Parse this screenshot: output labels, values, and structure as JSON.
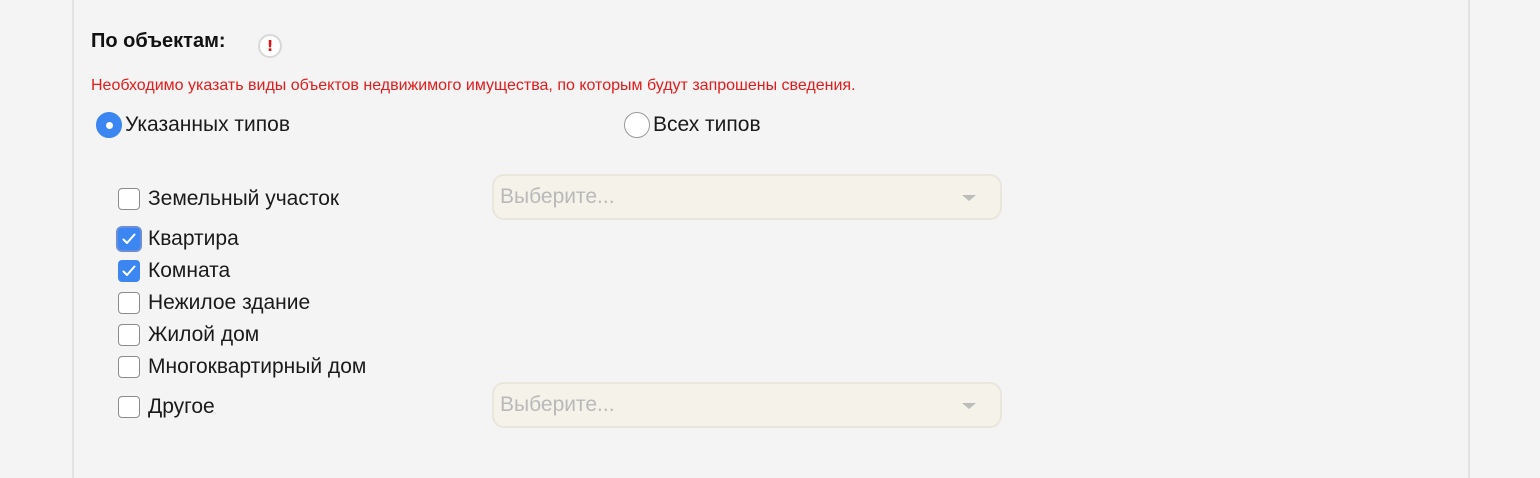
{
  "section": {
    "title": "По объектам:",
    "help_icon": "exclamation-icon",
    "error_message": "Необходимо указать виды объектов недвижимого имущества, по которым будут запрошены сведения."
  },
  "scope": {
    "options": [
      {
        "label": "Указанных типов",
        "checked": true
      },
      {
        "label": "Всех типов",
        "checked": false
      }
    ]
  },
  "object_types": [
    {
      "label": "Земельный участок",
      "checked": false
    },
    {
      "label": "Квартира",
      "checked": true
    },
    {
      "label": "Комната",
      "checked": true
    },
    {
      "label": "Нежилое здание",
      "checked": false
    },
    {
      "label": "Жилой дом",
      "checked": false
    },
    {
      "label": "Многоквартирный дом",
      "checked": false
    },
    {
      "label": "Другое",
      "checked": false
    }
  ],
  "selects": {
    "land_plot": {
      "placeholder": "Выберите..."
    },
    "other": {
      "placeholder": "Выберите..."
    }
  },
  "colors": {
    "accent": "#3b86f1",
    "error": "#e41b1b",
    "background": "#f4f4f4"
  }
}
